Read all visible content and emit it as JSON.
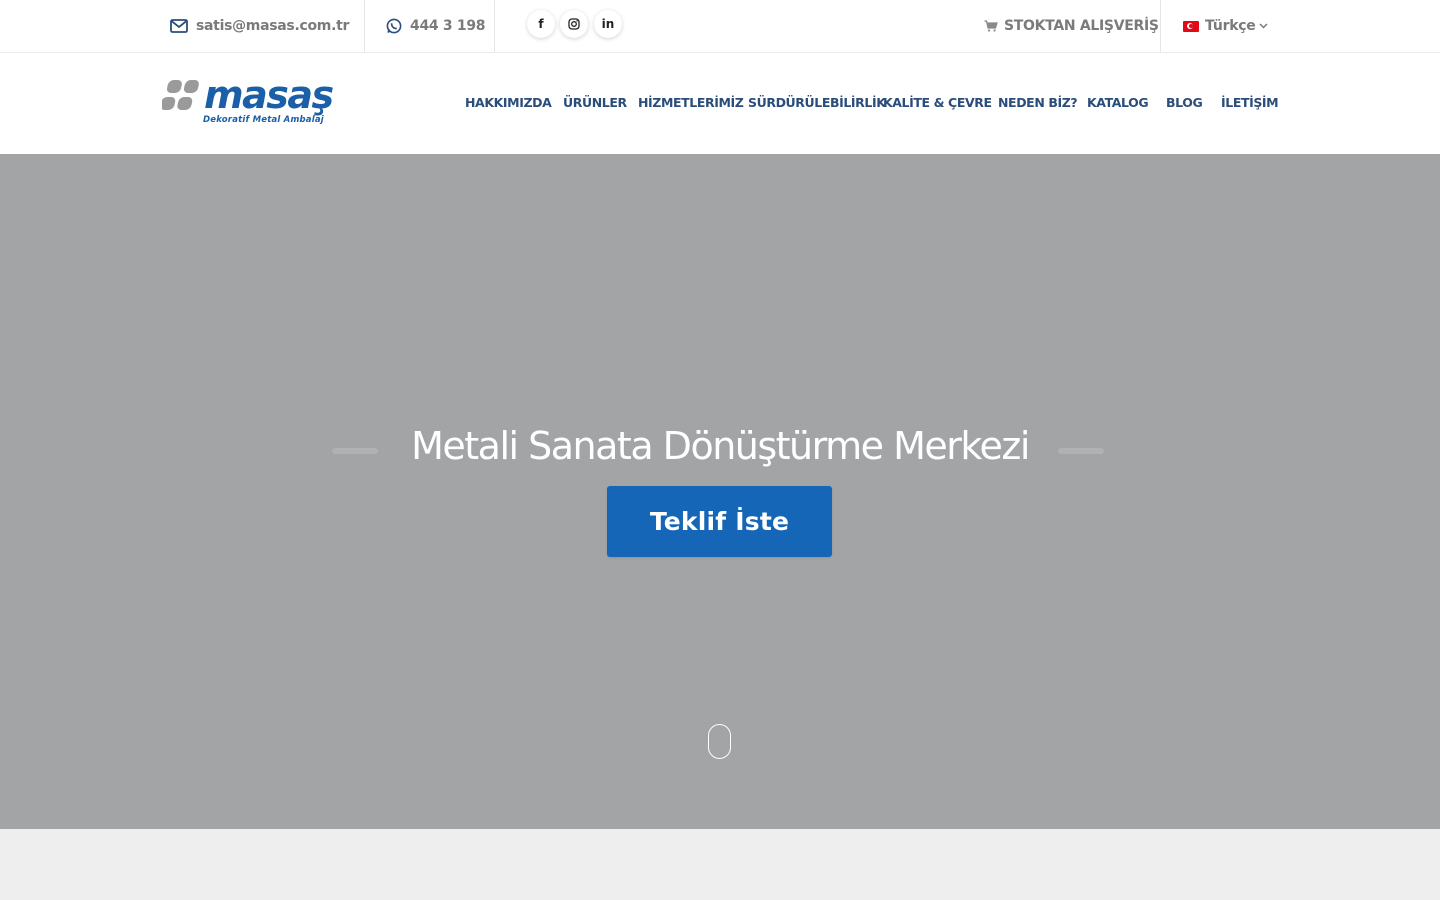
{
  "topbar": {
    "email": "satis@masas.com.tr",
    "phone": "444 3 198",
    "social": [
      {
        "name": "facebook",
        "glyph": "f"
      },
      {
        "name": "instagram",
        "glyph": "◎"
      },
      {
        "name": "linkedin",
        "glyph": "in"
      }
    ],
    "shop_label": "STOKTAN ALIŞVERİŞ",
    "language": "Türkçe"
  },
  "logo": {
    "name": "masaş",
    "tagline": "Dekoratif Metal Ambalaj"
  },
  "nav": {
    "items": [
      {
        "label": "HAKKIMIZDA"
      },
      {
        "label": "ÜRÜNLER"
      },
      {
        "label": "HİZMETLERİMİZ"
      },
      {
        "label": "SÜRDÜRÜLEBİLİRLİK"
      },
      {
        "label": "KALİTE & ÇEVRE"
      },
      {
        "label": "NEDEN BİZ?"
      },
      {
        "label": "KATALOG"
      },
      {
        "label": "BLOG"
      },
      {
        "label": "İLETİŞİM"
      }
    ]
  },
  "hero": {
    "title": "Metali Sanata Dönüştürme Merkezi",
    "cta_label": "Teklif İste"
  },
  "colors": {
    "brand_blue": "#1666b7",
    "nav_text": "#2b4d7a",
    "hero_bg": "#a3a4a6"
  }
}
